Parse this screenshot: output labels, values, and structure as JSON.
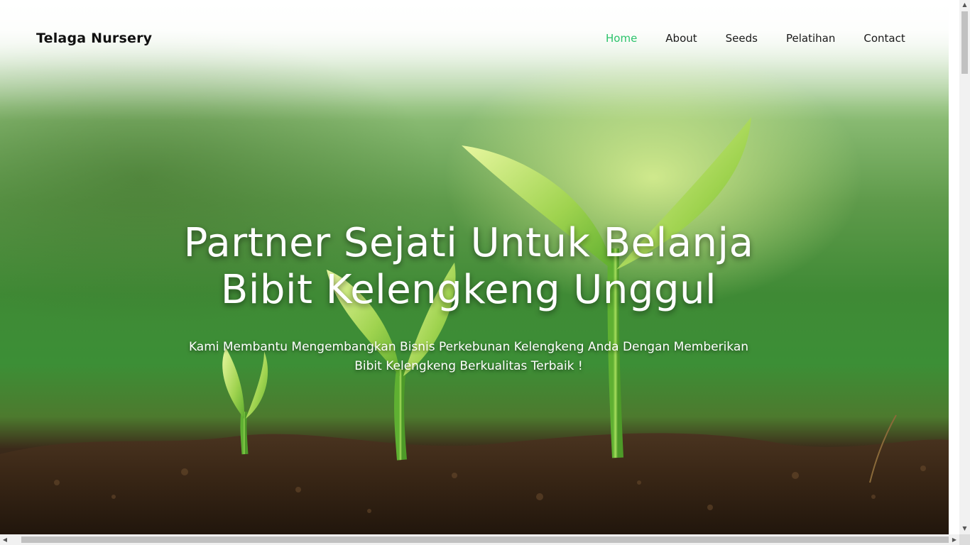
{
  "brand": "Telaga Nursery",
  "nav": {
    "items": [
      {
        "label": "Home",
        "active": true
      },
      {
        "label": "About",
        "active": false
      },
      {
        "label": "Seeds",
        "active": false
      },
      {
        "label": "Pelatihan",
        "active": false
      },
      {
        "label": "Contact",
        "active": false
      }
    ]
  },
  "hero": {
    "title_line1": "Partner Sejati Untuk Belanja",
    "title_line2": "Bibit Kelengkeng Unggul",
    "subtitle": "Kami Membantu Mengembangkan Bisnis Perkebunan Kelengkeng Anda Dengan Memberikan Bibit Kelengkeng Berkualitas Terbaik !",
    "image_icon": "seedling-sprouts-image"
  },
  "colors": {
    "accent": "#2cc36b",
    "text_dark": "#1a1a1a",
    "hero_text": "#ffffff"
  }
}
